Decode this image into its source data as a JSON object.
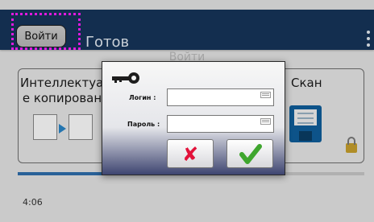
{
  "app": {
    "login_button_label": "Войти",
    "status": "Готов"
  },
  "background": {
    "dialog_title": "Войти",
    "card_left_label": "Интеллектуал е копирован",
    "card_right_label": "Скан",
    "time": "4:06",
    "progress_fraction": 0.5
  },
  "dialog": {
    "login_label": "Логин :",
    "login_value": "",
    "password_label": "Пароль :",
    "password_value": ""
  },
  "colors": {
    "topbar": "#16355b",
    "highlight": "#ff1dff",
    "cancel": "#e2123a",
    "ok": "#3fa62e"
  },
  "icons": [
    "key-icon",
    "keyboard-icon",
    "cancel-x-icon",
    "ok-checkmark-icon",
    "floppy-save-icon",
    "lock-icon",
    "menu-dots-icon"
  ]
}
